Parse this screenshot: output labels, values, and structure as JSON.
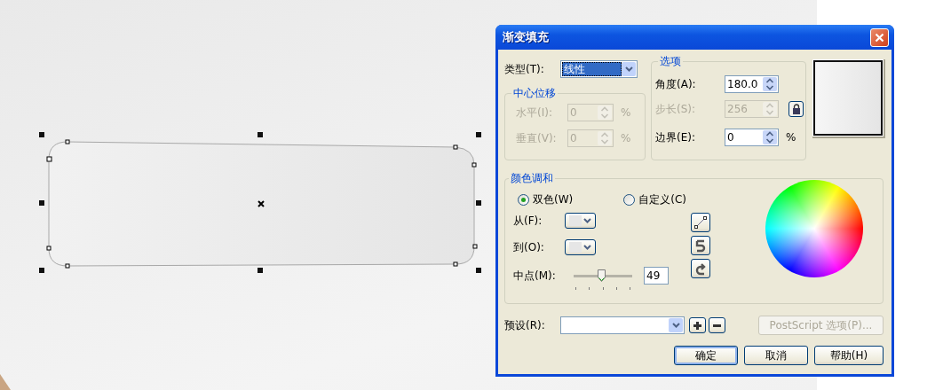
{
  "dialog": {
    "title": "渐变填充",
    "type_field": {
      "label": "类型(T):",
      "value": "线性"
    },
    "center_offset": {
      "title": "中心位移",
      "fields": [
        {
          "label": "水平(I):",
          "value": "0",
          "unit": "%",
          "disabled": true
        },
        {
          "label": "垂直(V):",
          "value": "0",
          "unit": "%",
          "disabled": true
        }
      ]
    },
    "options": {
      "title": "选项",
      "fields": [
        {
          "label": "角度(A):",
          "value": "180.0",
          "disabled": false
        },
        {
          "label": "步长(S):",
          "value": "256",
          "disabled": true,
          "lock": true
        },
        {
          "label": "边界(E):",
          "value": "0",
          "unit": "%",
          "disabled": false
        }
      ]
    },
    "color_blend": {
      "title": "颜色调和",
      "modes": [
        {
          "label": "双色(W)",
          "selected": true
        },
        {
          "label": "自定义(C)",
          "selected": false
        }
      ],
      "from": {
        "label": "从(F):"
      },
      "to": {
        "label": "到(O):"
      },
      "midpoint": {
        "label": "中点(M):",
        "level": 0.49,
        "value": "49"
      }
    },
    "presets": {
      "label": "预设(R):"
    },
    "postscript_button": {
      "label": "PostScript 选项(P)...",
      "disabled": true
    },
    "buttons": [
      {
        "label": "确定",
        "default": true
      },
      {
        "label": "取消",
        "default": false
      },
      {
        "label": "帮助(H)",
        "default": false
      }
    ]
  }
}
